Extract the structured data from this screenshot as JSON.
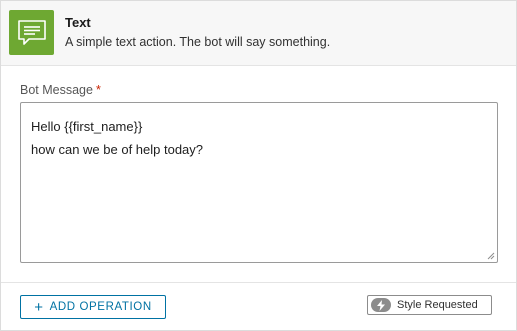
{
  "header": {
    "title": "Text",
    "description": "A simple text action. The bot will say something.",
    "icon": "speech-bubble-text-icon",
    "icon_bg": "#6ea832"
  },
  "field": {
    "label": "Bot Message",
    "required_mark": "*",
    "lines": [
      "Hello {{first_name}}",
      "how can we be of help today?"
    ]
  },
  "footer": {
    "add_operation_icon": "+",
    "add_operation_label": "ADD OPERATION",
    "style_requested_label": "Style Requested",
    "style_requested_icon": "lightning-bolt-icon"
  },
  "colors": {
    "accent": "#0072a3",
    "required": "#c92100"
  }
}
